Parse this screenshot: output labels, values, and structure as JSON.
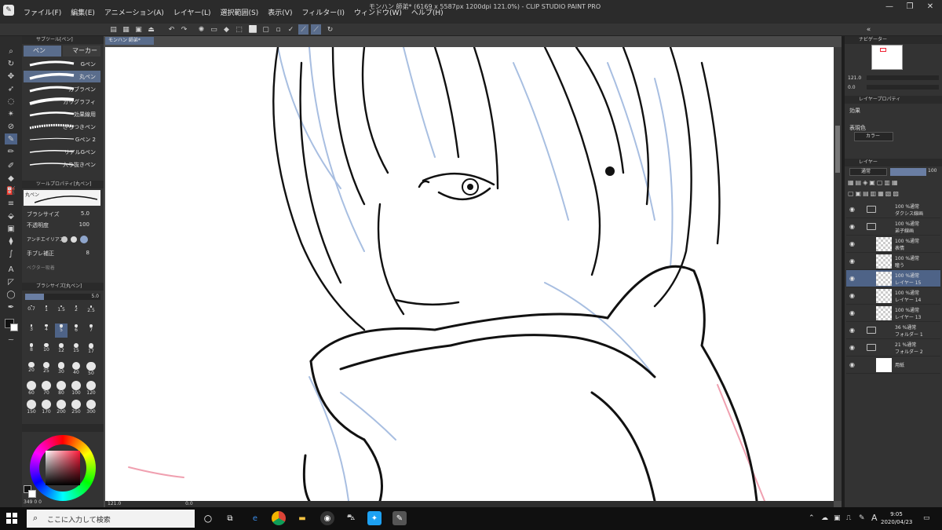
{
  "window": {
    "title": "モンハン 師弟* (6169 x 5587px 1200dpi 121.0%) - CLIP STUDIO PAINT PRO",
    "menu": [
      "ファイル(F)",
      "編集(E)",
      "アニメーション(A)",
      "レイヤー(L)",
      "選択範囲(S)",
      "表示(V)",
      "フィルター(I)",
      "ウィンドウ(W)",
      "ヘルプ(H)"
    ]
  },
  "document_tab": "モンハン 師弟*",
  "subtool": {
    "header": "サブツール[ペン]",
    "tabs": [
      "ペン",
      "マーカー"
    ],
    "brushes": [
      "Gペン",
      "丸ペン",
      "カブラペン",
      "カリグラフィ",
      "効果線用",
      "ざらつきペン",
      "Gペン 2",
      "リアルGペン",
      "入り抜きペン"
    ],
    "selected_brush": "丸ペン"
  },
  "tool_property": {
    "header": "ツールプロパティ[丸ペン]",
    "brush_label": "丸ペン",
    "brush_size_label": "ブラシサイズ",
    "brush_size_value": "5.0",
    "opacity_label": "不透明度",
    "opacity_value": "100",
    "antialias_label": "アンチエイリアス",
    "stabilization_label": "手ブレ補正",
    "stabilization_value": "8",
    "vector_label": "ベクター吸着"
  },
  "brush_size_panel": {
    "header": "ブラシサイズ[丸ペン]",
    "current": "5.0",
    "sizes": [
      "0.7",
      "1",
      "1.5",
      "2",
      "2.5",
      "3",
      "4",
      "5",
      "6",
      "7",
      "8",
      "10",
      "12",
      "15",
      "17",
      "20",
      "25",
      "30",
      "40",
      "50",
      "60",
      "70",
      "80",
      "100",
      "120",
      "150",
      "170",
      "200",
      "250",
      "300"
    ],
    "selected": "5"
  },
  "color": {
    "main": "#111111",
    "sub": "#ffffff",
    "wheel_value": "349",
    "wheel_s": "0",
    "wheel_v": "0"
  },
  "canvas_status": {
    "zoom": "121.0",
    "rotation": "0.0"
  },
  "navigator": {
    "header": "ナビゲーター",
    "zoom": "121.0",
    "rotation": "0.0"
  },
  "layer_property": {
    "header": "レイヤープロパティ",
    "effect_label": "効果",
    "display_color_label": "表現色",
    "display_color_value": "カラー"
  },
  "layer_panel": {
    "header": "レイヤー",
    "blend_mode": "通常",
    "opacity": "100",
    "layers": [
      {
        "mode": "100 %通常",
        "name": "ダクシス線画",
        "type": "folder",
        "selected": false
      },
      {
        "mode": "100 %通常",
        "name": "弟子線画",
        "type": "folder",
        "selected": false
      },
      {
        "mode": "100 %通常",
        "name": "表情",
        "type": "raster",
        "selected": false
      },
      {
        "mode": "100 %通常",
        "name": "瞳う",
        "type": "raster",
        "selected": false
      },
      {
        "mode": "100 %通常",
        "name": "レイヤー 15",
        "type": "raster",
        "selected": true
      },
      {
        "mode": "100 %通常",
        "name": "レイヤー 14",
        "type": "raster",
        "selected": false
      },
      {
        "mode": "100 %通常",
        "name": "レイヤー 13",
        "type": "raster",
        "selected": false
      },
      {
        "mode": "36 %通常",
        "name": "フォルダー 1",
        "type": "folder",
        "selected": false
      },
      {
        "mode": "21 %通常",
        "name": "フォルダー 2",
        "type": "folder",
        "selected": false
      },
      {
        "mode": "",
        "name": "用紙",
        "type": "paper",
        "selected": false
      }
    ]
  },
  "taskbar": {
    "search_placeholder": "ここに入力して検索",
    "time": "9:05",
    "date": "2020/04/23",
    "ime": "A"
  }
}
